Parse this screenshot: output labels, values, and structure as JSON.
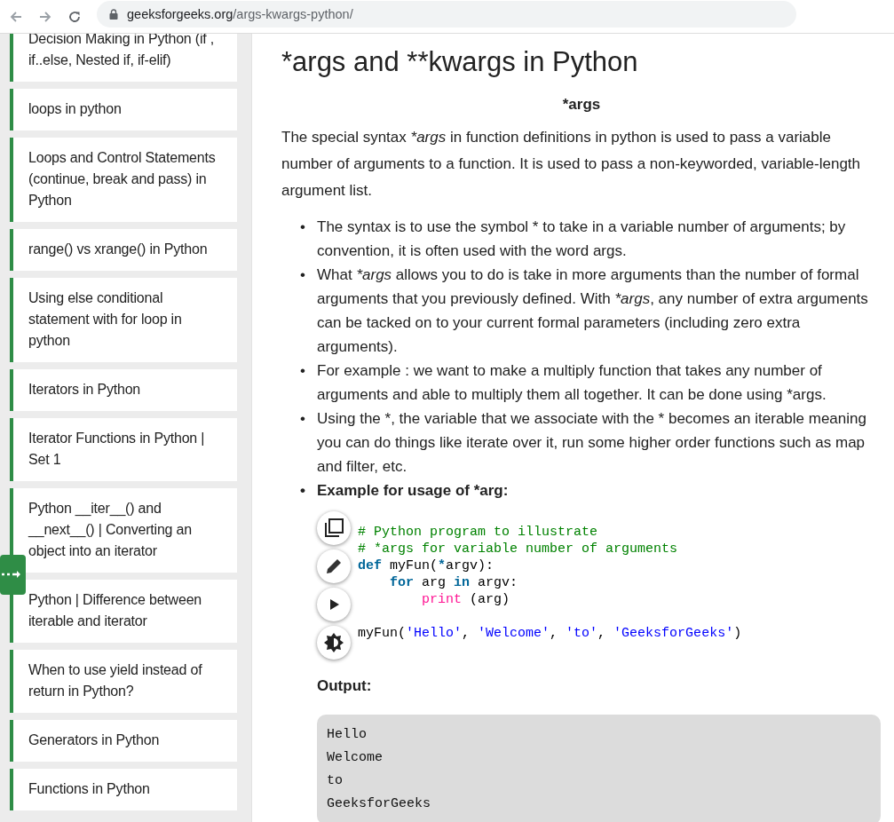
{
  "browser": {
    "url_host": "geeksforgeeks.org",
    "url_path": "/args-kwargs-python/"
  },
  "sidebar": {
    "items": [
      {
        "label": "Decision Making in Python (if , if..else, Nested if, if-elif)"
      },
      {
        "label": "loops in python"
      },
      {
        "label": "Loops and Control Statements (continue, break and pass) in Python"
      },
      {
        "label": "range() vs xrange() in Python"
      },
      {
        "label": "Using else conditional statement with for loop in python"
      },
      {
        "label": "Iterators in Python"
      },
      {
        "label": "Iterator Functions in Python | Set 1"
      },
      {
        "label": "Python __iter__() and __next__() | Converting an object into an iterator"
      },
      {
        "label": "Python | Difference between iterable and iterator"
      },
      {
        "label": "When to use yield instead of return in Python?"
      },
      {
        "label": "Generators in Python"
      },
      {
        "label": "Functions in Python"
      }
    ]
  },
  "article": {
    "title": "*args and **kwargs in Python",
    "subtitle": "*args",
    "intro": [
      {
        "t": "The special syntax ",
        "italic": false
      },
      {
        "t": "*args",
        "italic": true
      },
      {
        "t": " in function definitions in python is used to pass a variable number of arguments to a function. It is used to pass a non-keyworded, variable-length argument list.",
        "italic": false
      }
    ],
    "bullets": [
      {
        "marker": "•",
        "runs": [
          {
            "t": "The syntax is to use the symbol * to take in a variable number of arguments; by convention, it is often used with the word args.",
            "italic": false
          }
        ]
      },
      {
        "marker": "•",
        "runs": [
          {
            "t": "What ",
            "italic": false
          },
          {
            "t": "*args",
            "italic": true
          },
          {
            "t": " allows you to do is take in more arguments than the number of formal arguments that you previously defined. With ",
            "italic": false
          },
          {
            "t": "*args",
            "italic": true
          },
          {
            "t": ", any number of extra arguments can be tacked on to your current formal parameters (including zero extra arguments).",
            "italic": false
          }
        ]
      },
      {
        "marker": "•",
        "runs": [
          {
            "t": "For example : we want to make a multiply function that takes any number of arguments and able to multiply them all together. It can be done using *args.",
            "italic": false
          }
        ]
      },
      {
        "marker": "•",
        "runs": [
          {
            "t": "Using the *, the variable that we associate with the * becomes an iterable meaning you can do things like iterate over it, run some higher order functions such as map and filter, etc.",
            "italic": false
          }
        ]
      }
    ],
    "example_marker": "•",
    "example_heading": "Example for usage of *arg:",
    "code_lines": [
      {
        "gap_before": false,
        "tokens": [
          {
            "t": "# Python program to illustrate",
            "kind": "comment"
          }
        ]
      },
      {
        "gap_before": false,
        "tokens": [
          {
            "t": "# *args for variable number of arguments",
            "kind": "comment"
          }
        ]
      },
      {
        "gap_before": false,
        "tokens": [
          {
            "t": "def",
            "kind": "keyword"
          },
          {
            "t": " myFun(",
            "kind": "plain"
          },
          {
            "t": "*",
            "kind": "keyword"
          },
          {
            "t": "argv):",
            "kind": "plain"
          }
        ]
      },
      {
        "gap_before": false,
        "tokens": [
          {
            "t": "    for",
            "kind": "keyword"
          },
          {
            "t": " arg ",
            "kind": "plain"
          },
          {
            "t": "in",
            "kind": "keyword"
          },
          {
            "t": " argv:",
            "kind": "plain"
          }
        ]
      },
      {
        "gap_before": false,
        "tokens": [
          {
            "t": "        print",
            "kind": "builtin"
          },
          {
            "t": " (arg)",
            "kind": "plain"
          }
        ]
      },
      {
        "gap_before": true,
        "tokens": [
          {
            "t": "myFun(",
            "kind": "plain"
          },
          {
            "t": "'Hello'",
            "kind": "string"
          },
          {
            "t": ", ",
            "kind": "plain"
          },
          {
            "t": "'Welcome'",
            "kind": "string"
          },
          {
            "t": ", ",
            "kind": "plain"
          },
          {
            "t": "'to'",
            "kind": "string"
          },
          {
            "t": ", ",
            "kind": "plain"
          },
          {
            "t": "'GeeksforGeeks'",
            "kind": "string"
          },
          {
            "t": ")",
            "kind": "plain"
          }
        ]
      }
    ],
    "output_heading": "Output:",
    "output_lines": [
      "Hello",
      "Welcome",
      "to",
      "GeeksforGeeks"
    ]
  }
}
